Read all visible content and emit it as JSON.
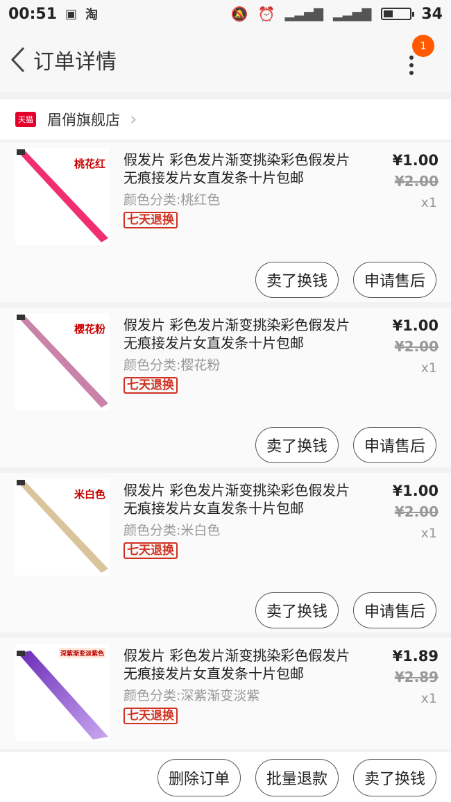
{
  "status": {
    "time": "00:51",
    "battery": "34",
    "battery_level": 0.34
  },
  "nav": {
    "title": "订单详情",
    "badge": "1"
  },
  "shop": {
    "badge": "天猫",
    "name": "眉俏旗舰店"
  },
  "items": [
    {
      "tag": "桃花红",
      "title": "假发片 彩色发片渐变挑染彩色假发片 无痕接发片女直发条十片包邮",
      "spec": "颜色分类:桃红色",
      "badge": "七天退换",
      "price": "¥1.00",
      "orig": "¥2.00",
      "qty": "x1",
      "btn1": "卖了换钱",
      "btn2": "申请售后",
      "color": "#f0306e"
    },
    {
      "tag": "樱花粉",
      "title": "假发片 彩色发片渐变挑染彩色假发片 无痕接发片女直发条十片包邮",
      "spec": "颜色分类:樱花粉",
      "badge": "七天退换",
      "price": "¥1.00",
      "orig": "¥2.00",
      "qty": "x1",
      "btn1": "卖了换钱",
      "btn2": "申请售后",
      "color": "#c982a8"
    },
    {
      "tag": "米白色",
      "title": "假发片 彩色发片渐变挑染彩色假发片 无痕接发片女直发条十片包邮",
      "spec": "颜色分类:米白色",
      "badge": "七天退换",
      "price": "¥1.00",
      "orig": "¥2.00",
      "qty": "x1",
      "btn1": "卖了换钱",
      "btn2": "申请售后",
      "color": "#d9c49c"
    },
    {
      "tag": "深紫渐变淡紫色",
      "title": "假发片 彩色发片渐变挑染彩色假发片 无痕接发片女直发条十片包邮",
      "spec": "颜色分类:深紫渐变淡紫",
      "badge": "七天退换",
      "price": "¥1.89",
      "orig": "¥2.89",
      "qty": "x1",
      "color": "#6a2bb8",
      "color2": "#c9a8f0"
    }
  ],
  "bottom": {
    "delete": "删除订单",
    "refund": "批量退款",
    "sell": "卖了换钱"
  },
  "icons": [
    "back-icon",
    "more-icon",
    "chevron-right-icon",
    "image-icon",
    "mute-icon",
    "alarm-icon",
    "signal-icon",
    "battery-icon"
  ]
}
